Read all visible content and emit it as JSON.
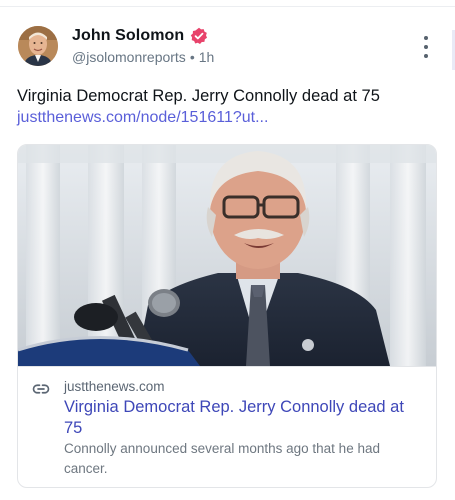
{
  "author": {
    "display_name": "John Solomon",
    "handle": "@jsolomonreports",
    "separator": "•",
    "timestamp": "1h",
    "avatar_icon": "avatar-photo",
    "verified_icon": "verified-badge-icon",
    "verified_color": "#e8436b"
  },
  "post": {
    "text": "Virginia Democrat Rep. Jerry Connolly dead at 75",
    "link_text": "justthenews.com/node/151611?ut..."
  },
  "link_card": {
    "image_icon": "article-photo",
    "link_icon": "link-icon",
    "domain": "justthenews.com",
    "title": "Virginia Democrat Rep. Jerry Connolly dead at 75",
    "description": "Connolly announced several months ago that he had cancer."
  },
  "menu": {
    "more_icon": "more-vertical-icon"
  },
  "colors": {
    "link": "#5a5fd9",
    "card_title": "#3e47b8",
    "verified": "#e8436b"
  }
}
